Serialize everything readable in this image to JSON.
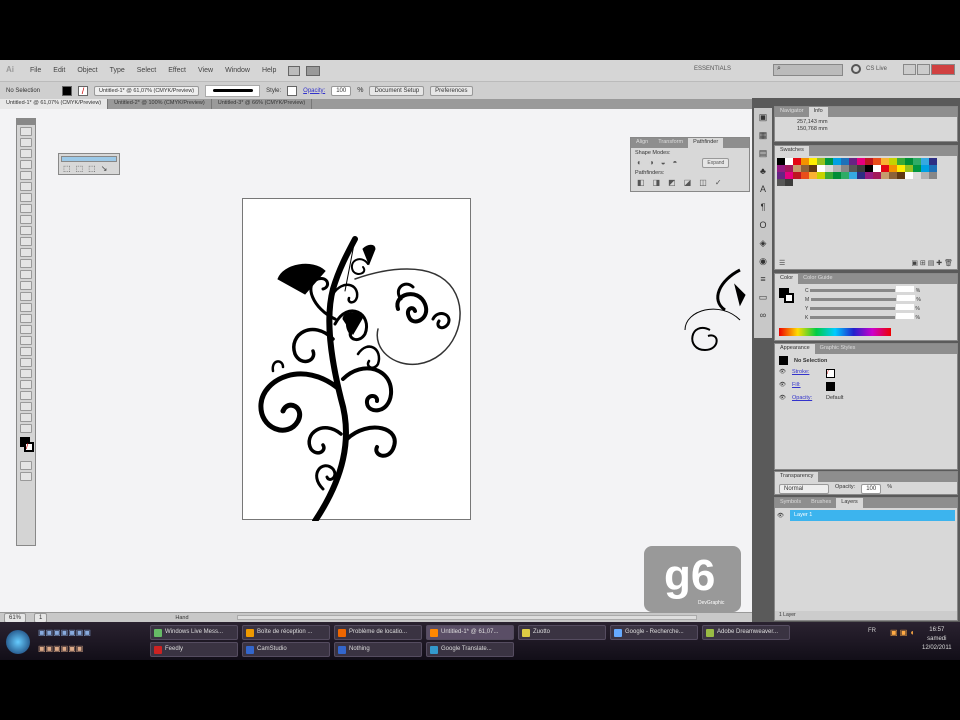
{
  "menu": {
    "items": [
      "File",
      "Edit",
      "Object",
      "Type",
      "Select",
      "Effect",
      "View",
      "Window",
      "Help"
    ],
    "workspace": "ESSENTIALS",
    "search_placeholder": "",
    "cs_live": "CS Live"
  },
  "control": {
    "selection": "No Selection",
    "tooltip": "Untitled-1* @ 61,07% (CMYK/Preview)",
    "style_label": "Style:",
    "opacity_label": "Opacity:",
    "opacity": "100",
    "unit": "%",
    "document_setup": "Document Setup",
    "preferences": "Preferences"
  },
  "tabs": [
    "Untitled-1* @ 61,07% (CMYK/Preview)",
    "Untitled-2* @ 100% (CMYK/Preview)",
    "Untitled-3* @ 66% (CMYK/Preview)"
  ],
  "pathfinder": {
    "tabs": [
      "Align",
      "Transform",
      "Pathfinder"
    ],
    "shape_modes": "Shape Modes:",
    "expand": "Expand",
    "pathfinders": "Pathfinders:"
  },
  "transform": {
    "tabs": [
      "Navigator",
      "Info"
    ],
    "x": "257,143 mm",
    "y": "150,768 mm"
  },
  "swatches": {
    "title": "Swatches",
    "colors": [
      "#000000",
      "#ffffff",
      "#e30613",
      "#f39200",
      "#ffed00",
      "#95c11f",
      "#009640",
      "#00a0e3",
      "#1d71b8",
      "#662483",
      "#e6007e",
      "#be1622",
      "#e94e1b",
      "#f9b233",
      "#c6d300",
      "#3aaa35",
      "#008d36",
      "#2fac66",
      "#36a9e1",
      "#2d2e83",
      "#951b81",
      "#a3195b",
      "#c69c6d",
      "#8c6239",
      "#603813",
      "#ffffff",
      "#dadada",
      "#b2b2b2",
      "#878787",
      "#575756",
      "#3c3c3b"
    ]
  },
  "color": {
    "tabs": [
      "Color",
      "Color Guide"
    ],
    "channels": [
      "C",
      "M",
      "Y",
      "K"
    ],
    "unit": "%"
  },
  "appearance": {
    "tabs": [
      "Appearance",
      "Graphic Styles"
    ],
    "title": "No Selection",
    "rows": [
      {
        "label": "Stroke:"
      },
      {
        "label": "Fill:"
      },
      {
        "label": "Opacity:",
        "value": "Default"
      }
    ]
  },
  "transparency": {
    "title": "Transparency",
    "mode": "Normal",
    "opacity_label": "Opacity:",
    "opacity": "100",
    "unit": "%"
  },
  "layers": {
    "tabs": [
      "Symbols",
      "Brushes",
      "Layers"
    ],
    "layer": "Layer 1",
    "count": "1 Layer"
  },
  "status": {
    "zoom": "61%",
    "page": "1",
    "tool": "Hand"
  },
  "taskbar": {
    "row1": [
      "Windows Live Mess...",
      "Boîte de réception ...",
      "Problème de locatio...",
      "Untitled-1* @ 61,07...",
      "Zuotto",
      "Google - Recherche...",
      "Adobe Dreamweaver..."
    ],
    "row2": [
      "Feedly",
      "CamStudio",
      "Nothing",
      "Google Translate..."
    ],
    "lang": "FR",
    "clock": "16:57",
    "day": "samedi",
    "date": "12/02/2011"
  },
  "logo": {
    "text": "g6",
    "sub": "DevGraphic"
  }
}
